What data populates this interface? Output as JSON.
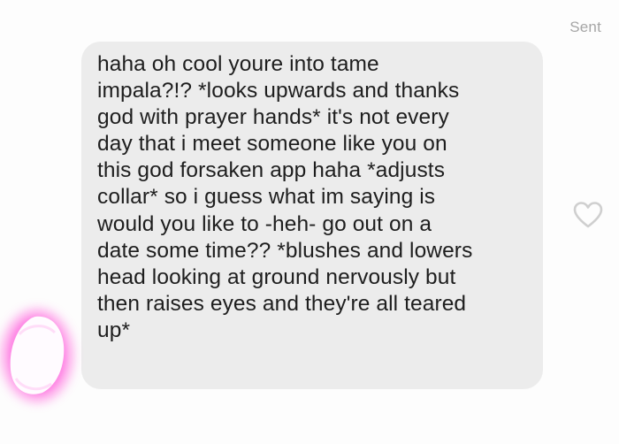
{
  "status": {
    "sent_label": "Sent"
  },
  "message": {
    "text": "haha oh cool youre into tame\nimpala?!? *looks upwards and thanks\ngod with prayer hands* it's not every\nday that i meet someone like you on\nthis god forsaken app haha *adjusts\ncollar* so i guess what im saying is\nwould you like to -heh- go out on a\ndate some time?? *blushes and lowers\nhead looking at ground nervously but\nthen raises eyes and they're all teared\nup*",
    "bubble_color": "#ececec",
    "text_color": "#1e1e1e"
  },
  "icons": {
    "like": "heart-outline-icon",
    "avatar": "redacted-avatar-scribble"
  },
  "colors": {
    "avatar_glow": "#ff4fd8",
    "heart_stroke": "#cfcfcf",
    "status_text": "#a6a6a6"
  }
}
